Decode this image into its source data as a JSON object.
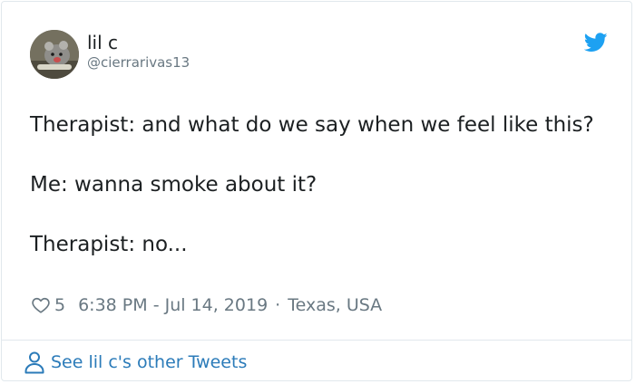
{
  "tweet": {
    "author_name": "lil c",
    "author_handle": "@cierrarivas13",
    "lines": [
      "Therapist: and what do we say when we feel like this?",
      "Me: wanna smoke about it?",
      "Therapist: no..."
    ],
    "likes": "5",
    "timestamp": "6:38 PM - Jul 14, 2019",
    "separator": "·",
    "location": "Texas, USA"
  },
  "footer": {
    "link_label": "See lil c's other Tweets"
  },
  "colors": {
    "accent": "#1da1f2",
    "link": "#2b7bb9",
    "muted": "#697882",
    "text": "#1c2022",
    "border": "#e1e8ed"
  },
  "icons": {
    "brand": "twitter-bird-icon",
    "like": "heart-icon",
    "profile": "person-icon"
  }
}
